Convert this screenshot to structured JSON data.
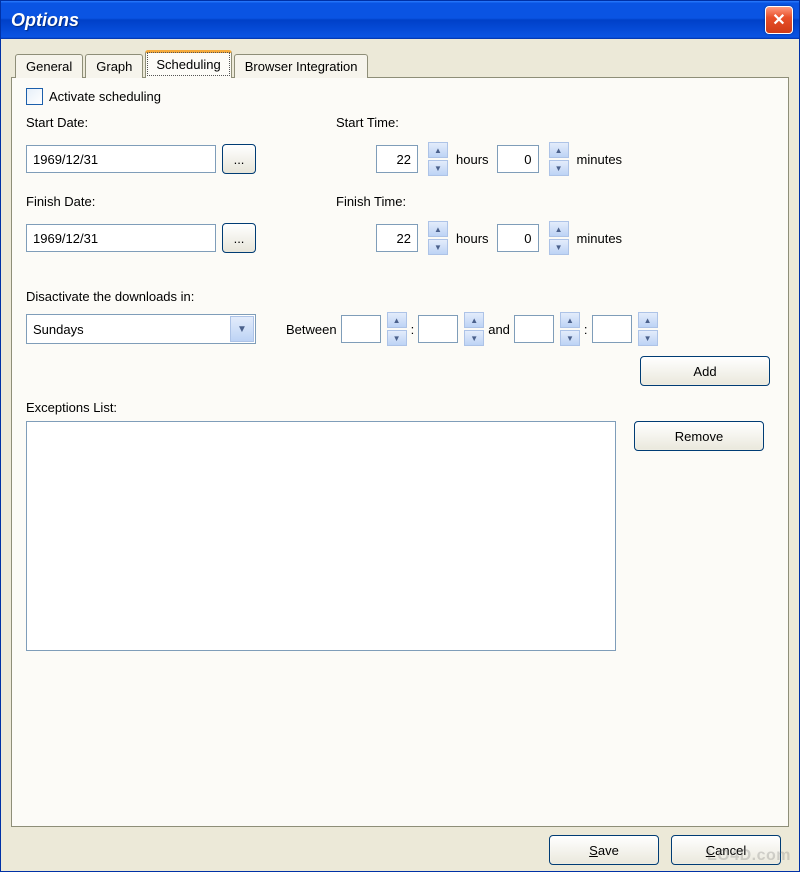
{
  "window": {
    "title": "Options"
  },
  "tabs": {
    "general": "General",
    "graph": "Graph",
    "scheduling": "Scheduling",
    "browser_integration": "Browser Integration"
  },
  "panel": {
    "activate_label": "Activate scheduling",
    "start_date_label": "Start Date:",
    "start_date_value": "1969/12/31",
    "finish_date_label": "Finish Date:",
    "finish_date_value": "1969/12/31",
    "start_time_label": "Start Time:",
    "finish_time_label": "Finish Time:",
    "start_time_hours": "22",
    "start_time_minutes": "0",
    "finish_time_hours": "22",
    "finish_time_minutes": "0",
    "hours_label": "hours",
    "minutes_label": "minutes",
    "ellipsis": "...",
    "disactivate_label": "Disactivate the downloads in:",
    "day_value": "Sundays",
    "between_label": "Between",
    "and_label": "and",
    "colon": ":",
    "add_label": "Add",
    "exceptions_label": "Exceptions List:",
    "remove_label": "Remove"
  },
  "footer": {
    "save": "Save",
    "cancel": "Cancel"
  },
  "watermark": "LO4D.com"
}
